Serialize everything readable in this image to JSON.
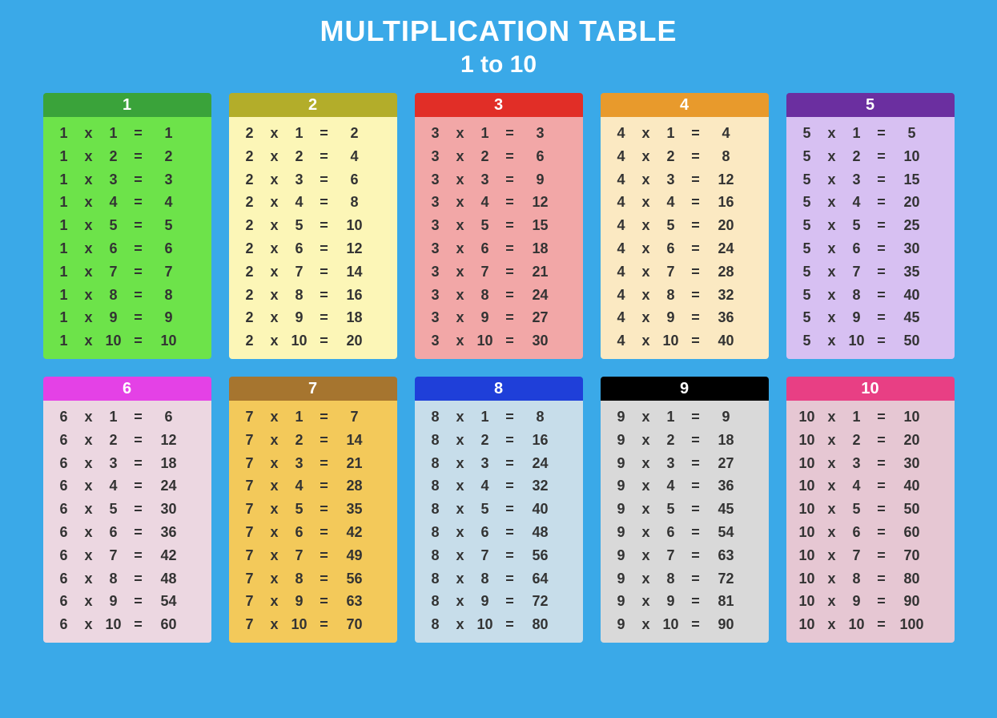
{
  "title": "MULTIPLICATION TABLE",
  "subtitle": "1 to 10",
  "symbols": {
    "times": "x",
    "equals": "="
  },
  "tables": [
    {
      "n": 1,
      "headerColor": "#3aa33a",
      "bodyColor": "#6de34a"
    },
    {
      "n": 2,
      "headerColor": "#b3ad2a",
      "bodyColor": "#fcf6b7"
    },
    {
      "n": 3,
      "headerColor": "#e12e27",
      "bodyColor": "#f2a7a7"
    },
    {
      "n": 4,
      "headerColor": "#e89a2c",
      "bodyColor": "#fbe9c2"
    },
    {
      "n": 5,
      "headerColor": "#6b2fa0",
      "bodyColor": "#d7c0f2"
    },
    {
      "n": 6,
      "headerColor": "#e441e6",
      "bodyColor": "#ecd7e1"
    },
    {
      "n": 7,
      "headerColor": "#a6752f",
      "bodyColor": "#f3c95a"
    },
    {
      "n": 8,
      "headerColor": "#1f3fd9",
      "bodyColor": "#c7ddea"
    },
    {
      "n": 9,
      "headerColor": "#000000",
      "bodyColor": "#d9d9d9"
    },
    {
      "n": 10,
      "headerColor": "#e83f84",
      "bodyColor": "#e6c7d3"
    }
  ],
  "multipliers": [
    1,
    2,
    3,
    4,
    5,
    6,
    7,
    8,
    9,
    10
  ]
}
